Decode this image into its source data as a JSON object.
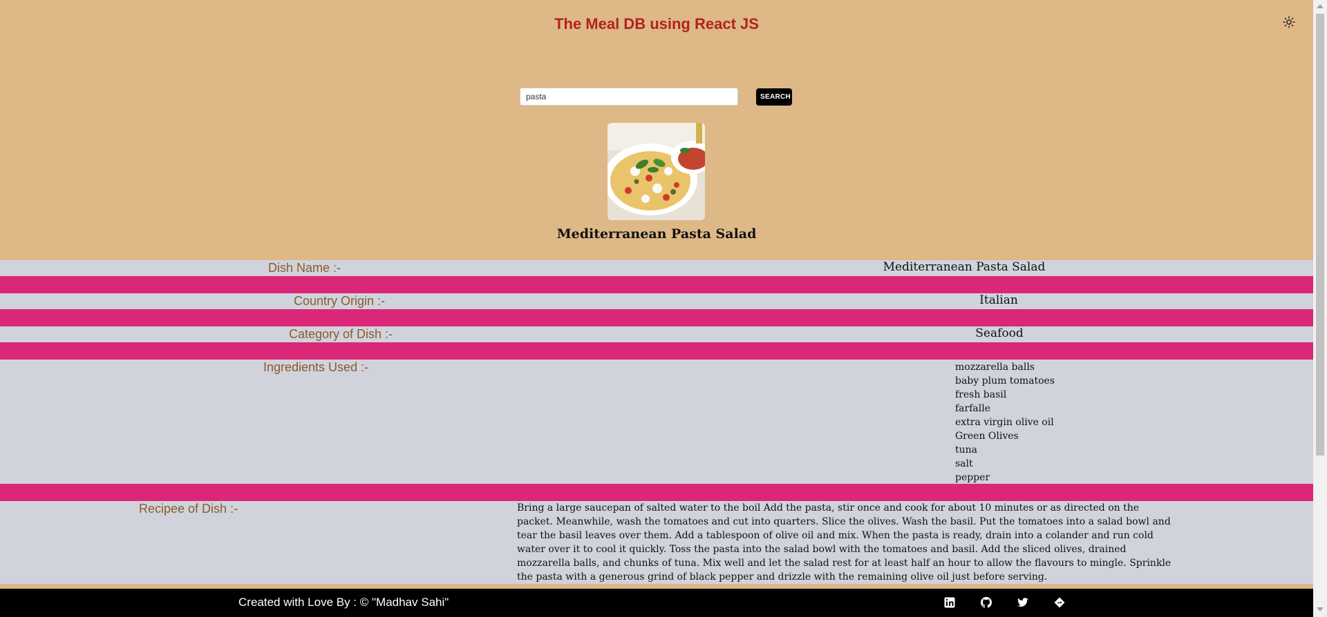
{
  "header": {
    "title": "The Meal DB using React JS",
    "theme_toggle_icon": "sun-icon"
  },
  "search": {
    "value": "pasta",
    "button_label": "SEARCH"
  },
  "meal": {
    "image_alt": "Mediterranean Pasta Salad",
    "title": "Mediterranean Pasta Salad",
    "details": {
      "dish_name_label": "Dish Name :-",
      "dish_name": "Mediterranean Pasta Salad",
      "country_label": "Country Origin :-",
      "country": "Italian",
      "category_label": "Category of Dish :-",
      "category": "Seafood",
      "ingredients_label": "Ingredients Used :-",
      "ingredients": [
        "mozzarella balls",
        "baby plum tomatoes",
        "fresh basil",
        "farfalle",
        "extra virgin olive oil",
        "Green Olives",
        "tuna",
        "salt",
        "pepper"
      ],
      "recipe_label": "Recipee of Dish :-",
      "recipe": "Bring a large saucepan of salted water to the boil Add the pasta, stir once and cook for about 10 minutes or as directed on the packet. Meanwhile, wash the tomatoes and cut into quarters. Slice the olives. Wash the basil. Put the tomatoes into a salad bowl and tear the basil leaves over them. Add a tablespoon of olive oil and mix. When the pasta is ready, drain into a colander and run cold water over it to cool it quickly. Toss the pasta into the salad bowl with the tomatoes and basil. Add the sliced olives, drained mozzarella balls, and chunks of tuna. Mix well and let the salad rest for at least half an hour to allow the flavours to mingle. Sprinkle the pasta with a generous grind of black pepper and drizzle with the remaining olive oil just before serving."
    }
  },
  "footer": {
    "credit": "Created with Love By : © \"Madhav Sahi\"",
    "social_icons": [
      "linkedin-icon",
      "github-icon",
      "twitter-icon",
      "website-icon"
    ]
  },
  "colors": {
    "page_background": "#DEB887",
    "title_red": "#B22222",
    "row_background": "#D0D3DB",
    "separator_pink": "#DB2777",
    "label_brown": "#8B5A2B",
    "footer_black": "#000000"
  }
}
